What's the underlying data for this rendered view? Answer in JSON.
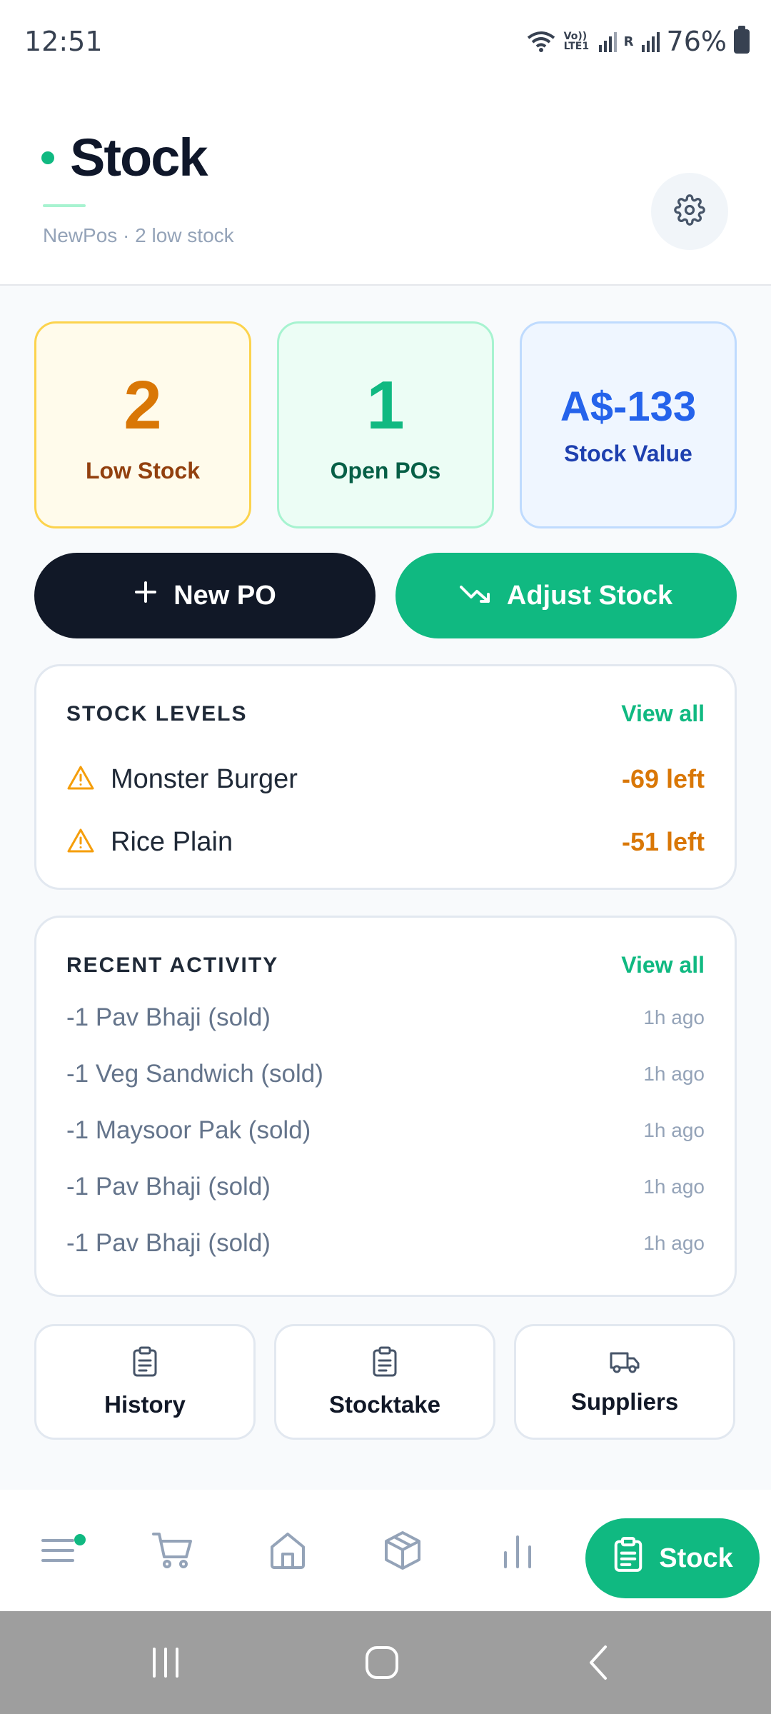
{
  "status_bar": {
    "time": "12:51",
    "network_label": "Vo)) LTE1",
    "roaming": "R",
    "battery": "76%"
  },
  "header": {
    "title": "Stock",
    "subtitle": "NewPos · 2 low stock",
    "settings_icon": "gear-icon"
  },
  "stats": [
    {
      "value": "2",
      "label": "Low Stock",
      "color": "#d97706"
    },
    {
      "value": "1",
      "label": "Open POs",
      "color": "#10b981"
    },
    {
      "value": "A$-133",
      "label": "Stock Value",
      "color": "#2563eb"
    }
  ],
  "actions": {
    "new_po": "New PO",
    "adjust_stock": "Adjust Stock"
  },
  "stock_levels": {
    "title": "STOCK LEVELS",
    "view_all": "View all",
    "items": [
      {
        "name": "Monster Burger",
        "left": "-69 left"
      },
      {
        "name": "Rice Plain",
        "left": "-51 left"
      }
    ]
  },
  "recent_activity": {
    "title": "RECENT ACTIVITY",
    "view_all": "View all",
    "items": [
      {
        "desc": "-1 Pav Bhaji (sold)",
        "ago": "1h ago"
      },
      {
        "desc": "-1 Veg Sandwich (sold)",
        "ago": "1h ago"
      },
      {
        "desc": "-1 Maysoor Pak (sold)",
        "ago": "1h ago"
      },
      {
        "desc": "-1 Pav Bhaji (sold)",
        "ago": "1h ago"
      },
      {
        "desc": "-1 Pav Bhaji (sold)",
        "ago": "1h ago"
      }
    ]
  },
  "tiles": [
    {
      "label": "History",
      "icon": "clipboard-icon"
    },
    {
      "label": "Stocktake",
      "icon": "clipboard-icon"
    },
    {
      "label": "Suppliers",
      "icon": "truck-icon"
    }
  ],
  "bottom_nav": {
    "items": [
      "menu-icon",
      "cart-icon",
      "home-icon",
      "box-icon",
      "chart-icon"
    ],
    "active_label": "Stock"
  },
  "colors": {
    "accent": "#10b981",
    "dark": "#111827",
    "warning": "#d97706",
    "info": "#2563eb"
  }
}
